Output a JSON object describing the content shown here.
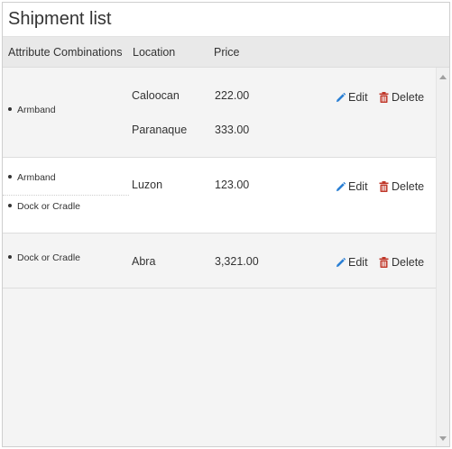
{
  "panel": {
    "title": "Shipment list"
  },
  "columns": {
    "attributes": "Attribute Combinations",
    "location": "Location",
    "price": "Price"
  },
  "actions": {
    "edit_label": "Edit",
    "delete_label": "Delete"
  },
  "rows": [
    {
      "attributes": [
        "Armband"
      ],
      "entries": [
        {
          "location": "Caloocan",
          "price": "222.00"
        },
        {
          "location": "Paranaque",
          "price": "333.00"
        }
      ]
    },
    {
      "attributes": [
        "Armband",
        "Dock or Cradle"
      ],
      "entries": [
        {
          "location": "Luzon",
          "price": "123.00"
        }
      ]
    },
    {
      "attributes": [
        "Dock or Cradle"
      ],
      "entries": [
        {
          "location": "Abra",
          "price": "3,321.00"
        }
      ]
    }
  ],
  "colors": {
    "edit_icon": "#2a7fd4",
    "delete_icon": "#c0392b",
    "header_bg": "#e9e9e9",
    "row_alt_bg": "#ffffff",
    "row_bg": "#f4f4f4"
  },
  "icons": {
    "edit": "pencil-icon",
    "delete": "trash-icon"
  }
}
